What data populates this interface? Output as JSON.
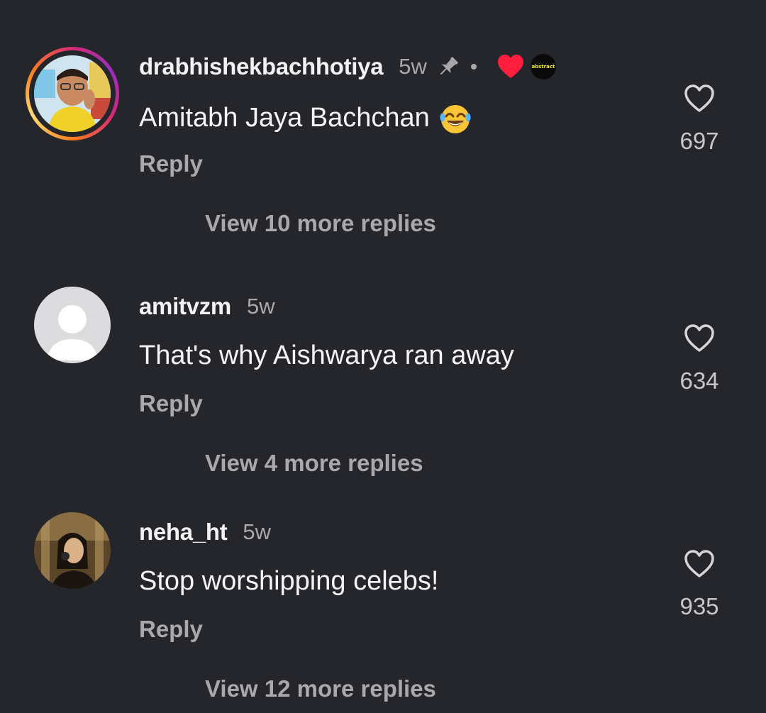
{
  "comments": [
    {
      "username": "drabhishekbachhotiya",
      "time": "5w",
      "text": "Amitabh Jaya Bachchan",
      "reply_label": "Reply",
      "view_replies": "View 10 more replies",
      "likes": "697",
      "pinned": true,
      "liked_by_creator": true,
      "creator_badge_text": "abstract",
      "has_story": true,
      "emoji": "face-with-tears-of-joy"
    },
    {
      "username": "amitvzm",
      "time": "5w",
      "text": "That's why Aishwarya ran away",
      "reply_label": "Reply",
      "view_replies": "View 4 more replies",
      "likes": "634",
      "pinned": false,
      "liked_by_creator": false,
      "has_story": false
    },
    {
      "username": "neha_ht",
      "time": "5w",
      "text": "Stop worshipping celebs!",
      "reply_label": "Reply",
      "view_replies": "View 12 more replies",
      "likes": "935",
      "pinned": false,
      "liked_by_creator": false,
      "has_story": false
    }
  ],
  "colors": {
    "background": "#25262b",
    "primary_text": "#f2f2f2",
    "secondary_text": "#a8a8ad",
    "liked_heart": "#ff1f3d"
  }
}
